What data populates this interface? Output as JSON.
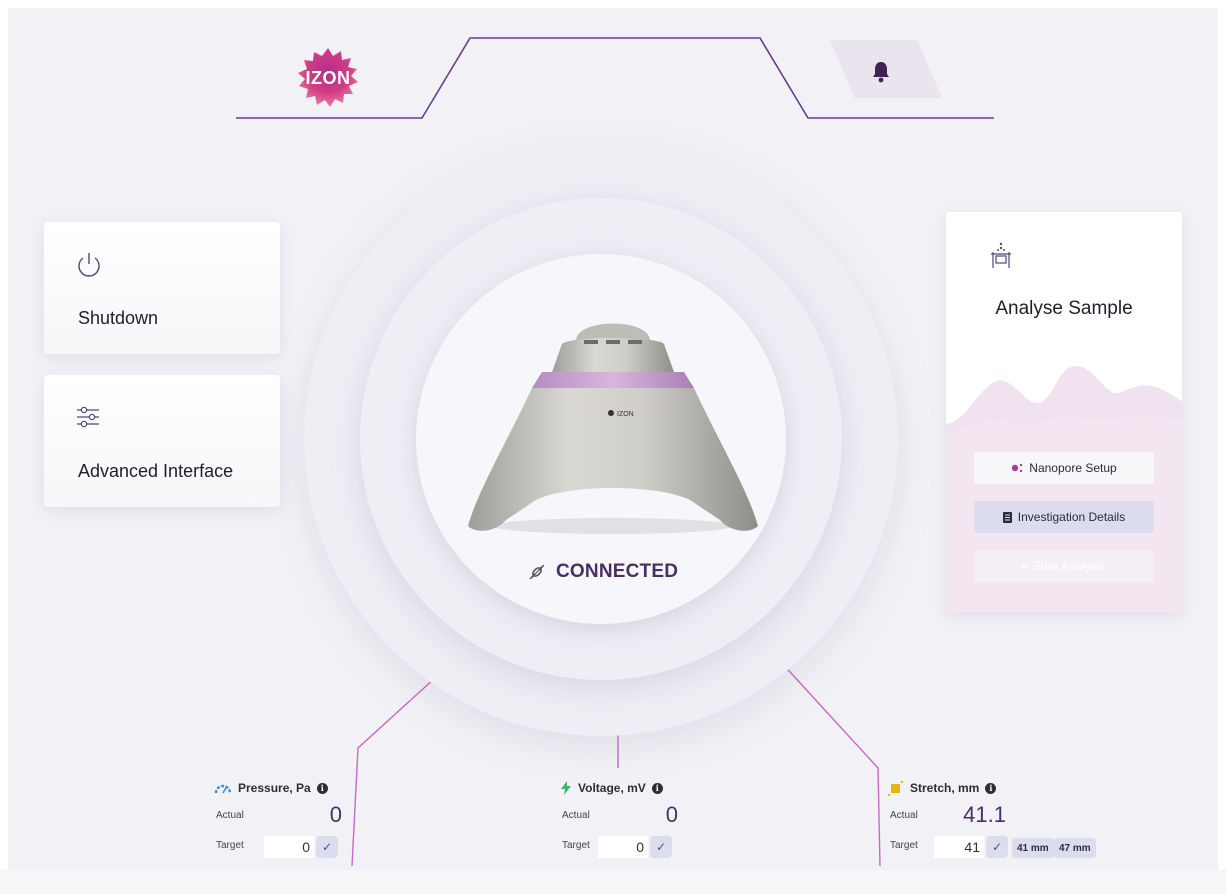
{
  "header": {
    "logo_text": "IZON"
  },
  "device": {
    "brand_label": "IZON",
    "status": "CONNECTED"
  },
  "cards": {
    "shutdown": {
      "title": "Shutdown"
    },
    "advanced": {
      "title": "Advanced Interface"
    },
    "analyse": {
      "title": "Analyse Sample",
      "buttons": {
        "nanopore_setup": "Nanopore Setup",
        "investigation_details": "Investigation Details",
        "start_analysis": "Start Analysis"
      }
    }
  },
  "gauges": {
    "pressure": {
      "label": "Pressure, Pa",
      "actual_label": "Actual",
      "actual": "0",
      "target_label": "Target",
      "target": "0"
    },
    "voltage": {
      "label": "Voltage, mV",
      "actual_label": "Actual",
      "actual": "0",
      "target_label": "Target",
      "target": "0"
    },
    "stretch": {
      "label": "Stretch, mm",
      "actual_label": "Actual",
      "actual": "41.1",
      "target_label": "Target",
      "target": "41",
      "presets": [
        "41 mm",
        "47 mm"
      ]
    }
  },
  "colors": {
    "accent_purple": "#4b2e63",
    "line_purple": "#7a3f98",
    "connector_pink": "#c867c8",
    "pressure_icon": "#3d8fd6",
    "voltage_icon": "#38b56a",
    "stretch_icon": "#e8b21a"
  }
}
